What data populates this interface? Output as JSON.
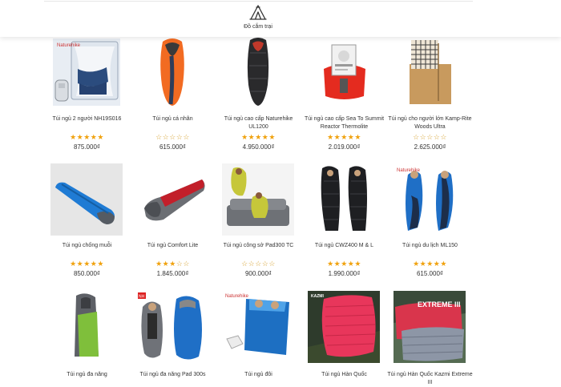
{
  "category_bar": {
    "item_label": "Đồ cắm trại",
    "item_icon": "tent-icon"
  },
  "colors": {
    "star_filled": "#f0a20f",
    "star_empty": "#d8a63a",
    "text": "#333333"
  },
  "products": [
    {
      "name": "Túi ngủ 2 người NH19S016",
      "rating": 5,
      "price": "875.000₫",
      "image": "double-sleeping-bag-photo"
    },
    {
      "name": "Túi ngủ cá nhân",
      "rating": 0,
      "price": "615.000₫",
      "image": "orange-mummy-bag-photo"
    },
    {
      "name": "Túi ngủ cao cấp Naturehike UL1200",
      "rating": 5,
      "price": "4.950.000₫",
      "image": "black-down-bag-photo"
    },
    {
      "name": "Túi ngủ cao cấp Sea To Summit Reactor Thermolite",
      "rating": 5,
      "price": "2.019.000₫",
      "image": "red-liner-pack-photo"
    },
    {
      "name": "Túi ngủ cho người lớn Kamp-Rite Woods Ultra",
      "rating": 0,
      "price": "2.625.000₫",
      "image": "rectangular-plaid-bag-photo"
    },
    {
      "name": "Túi ngủ chống muỗi",
      "rating": 5,
      "price": "850.000₫",
      "image": "blue-mummy-bag-photo"
    },
    {
      "name": "Túi ngủ Comfort Lite",
      "rating": 3,
      "price": "1.845.000₫",
      "image": "red-grey-bag-photo"
    },
    {
      "name": "Túi ngủ công sở Pad300 TC",
      "rating": 0,
      "price": "900.000₫",
      "image": "sofa-sleeping-bag-photo"
    },
    {
      "name": "Túi ngủ CWZ400 M & L",
      "rating": 5,
      "price": "1.990.000₫",
      "image": "two-black-bags-photo"
    },
    {
      "name": "Túi ngủ du lịch ML150",
      "rating": 5,
      "price": "615.000₫",
      "image": "blue-mummy-bags-photo"
    },
    {
      "name": "Túi ngủ đa năng",
      "rating": null,
      "price": "",
      "image": "grey-green-bag-photo"
    },
    {
      "name": "Túi ngủ đa năng Pad 300s",
      "rating": null,
      "price": "",
      "image": "blue-pad-bags-photo"
    },
    {
      "name": "Túi ngủ đôi",
      "rating": null,
      "price": "",
      "image": "double-blue-bag-photo"
    },
    {
      "name": "Túi ngủ Hàn Quốc",
      "rating": null,
      "price": "",
      "image": "kazmi-red-bag-photo",
      "image_text": "KAZMI"
    },
    {
      "name": "Túi ngủ Hàn Quốc Kazmi Extreme III",
      "rating": null,
      "price": "",
      "image": "kazmi-extreme-photo",
      "image_text": "EXTREME III"
    }
  ]
}
